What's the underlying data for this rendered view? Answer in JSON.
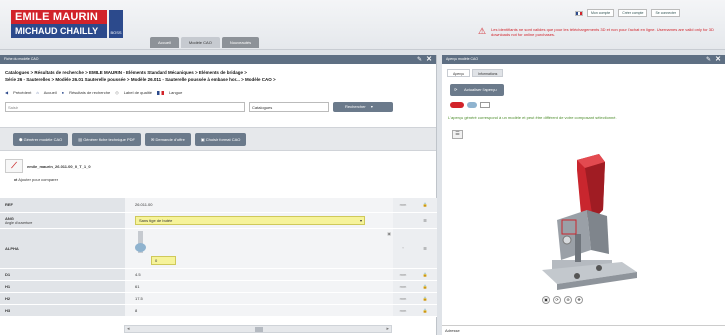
{
  "header": {
    "logo_top": "EMILE MAURIN",
    "logo_bottom": "MICHAUD CHAILLY",
    "logo_mark": "BOSS",
    "main_tabs": [
      {
        "label": "Accueil",
        "active": false
      },
      {
        "label": "Modèle CAO",
        "active": true
      },
      {
        "label": "Nouveautés",
        "active": false
      }
    ],
    "top_links": [
      "Mon compte",
      "Créer compte",
      "Se connecter"
    ],
    "warning": "Les identifiants ne sont valides que pour les téléchargements 3D et non pour l'achat en ligne. Usernames are valid only for 3D downloads not for online purchases."
  },
  "left_panel": {
    "title": "Fiche du modèle CAO",
    "breadcrumb_line1": "Catalogues > Résultats de recherche > EMILE MAURIN - Eléments Standard Mécaniques > Eléments de bridage >",
    "breadcrumb_line2": "Série 26 - Sauterelles > Modèle 26.01 Sauterelle poussée > Modèle 26.011 - Sauterelle poussée à embase hor... > Modèle CAO >",
    "nav": {
      "back": "Précédent",
      "home": "Accueil",
      "results": "Résultats de recherche",
      "quality": "Label de qualité",
      "language": "Langue"
    },
    "search": {
      "placeholder": "Saisir",
      "scope": "Catalogues",
      "button": "Rechercher"
    },
    "toolbar": {
      "generate_cad": "Générer modèle CAO",
      "generate_pdf": "Générer fiche technique PDF",
      "request_offer": "Demande d'offre",
      "choose_cad": "Choisir format CAO"
    },
    "part_name": "emile_maurin_26.011.00_0_T_1_0",
    "compare_label": "Ajouter pour comparer",
    "params": [
      {
        "name": "REF",
        "sub": "",
        "value": "26.011.00",
        "unit": "mm",
        "lock": "🔒"
      },
      {
        "name": "ANG",
        "sub": "Angle d'ouverture",
        "value": "Sans tige de butée",
        "unit": "",
        "lock": "☰"
      },
      {
        "name": "ALPHA",
        "sub": "",
        "value": "0",
        "unit": "°",
        "lock": "☰"
      },
      {
        "name": "D1",
        "sub": "",
        "value": "4.5",
        "unit": "mm",
        "lock": "🔒"
      },
      {
        "name": "H1",
        "sub": "",
        "value": "61",
        "unit": "mm",
        "lock": "🔒"
      },
      {
        "name": "H2",
        "sub": "",
        "value": "17.5",
        "unit": "mm",
        "lock": "🔒"
      },
      {
        "name": "H3",
        "sub": "",
        "value": "8",
        "unit": "mm",
        "lock": "🔒"
      }
    ]
  },
  "right_panel": {
    "title": "Aperçu modèle CAO",
    "tabs": [
      {
        "label": "Aperçu",
        "active": true
      },
      {
        "label": "Informations",
        "active": false
      }
    ],
    "update_button": "Actualiser l'aperçu",
    "note": "L'aperçu généré correspond à un modèle et peut être différent de votre composant sélectionné.",
    "address_label": "Adresse"
  },
  "colors": {
    "brand_red": "#d2232a",
    "brand_blue": "#2c4a8c",
    "panel_header": "#5e6f83",
    "button_gray": "#6b7a8b",
    "note_green": "#4d8d2c"
  }
}
